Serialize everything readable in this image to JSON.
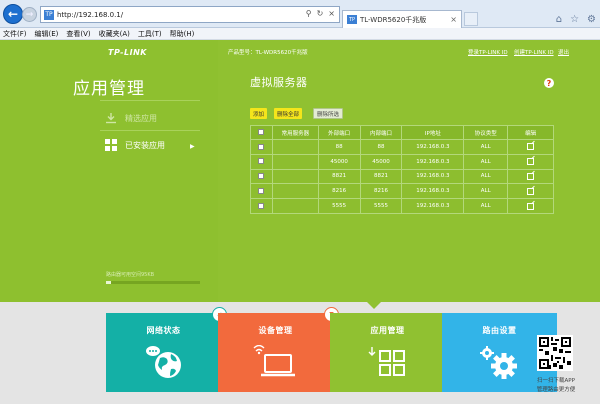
{
  "browser": {
    "url": "http://192.168.0.1/",
    "addr_favicon": "TP",
    "tab_title": "TL-WDR5620千兆版",
    "tab_favicon": "TP",
    "menu": [
      "文件(F)",
      "编辑(E)",
      "查看(V)",
      "收藏夹(A)",
      "工具(T)",
      "帮助(H)"
    ]
  },
  "header": {
    "logo": "TP-LINK",
    "model_label": "产品型号：TL-WDR5620千兆版",
    "login_id": "登录TP-LINK ID",
    "create_id": "创建TP-LINK ID",
    "exit": "退出"
  },
  "sidebar": {
    "title": "应用管理",
    "items": [
      {
        "label": "精选应用",
        "icon": "download-icon"
      },
      {
        "label": "已安装应用",
        "icon": "grid-icon",
        "arrow": "▶"
      }
    ],
    "storage_label": "路由器可用空间95KB",
    "storage_fraction": 0.05
  },
  "main": {
    "title": "虚拟服务器",
    "help": "?",
    "buttons": {
      "add": "添加",
      "delete_all": "删除全部",
      "delete_selected": "删除所选"
    },
    "columns": [
      "常用服务器",
      "外部端口",
      "内部端口",
      "IP地址",
      "协议类型",
      "编辑"
    ],
    "rows": [
      {
        "server": "",
        "external": "88",
        "internal": "88",
        "ip": "192.168.0.3",
        "protocol": "ALL"
      },
      {
        "server": "",
        "external": "45000",
        "internal": "45000",
        "ip": "192.168.0.3",
        "protocol": "ALL"
      },
      {
        "server": "",
        "external": "8821",
        "internal": "8821",
        "ip": "192.168.0.3",
        "protocol": "ALL"
      },
      {
        "server": "",
        "external": "8216",
        "internal": "8216",
        "ip": "192.168.0.3",
        "protocol": "ALL"
      },
      {
        "server": "",
        "external": "5555",
        "internal": "5555",
        "ip": "192.168.0.3",
        "protocol": "ALL"
      }
    ]
  },
  "tiles": [
    {
      "label": "网络状态",
      "color": "#14b0a6",
      "badge": "✓",
      "icon": "globe-icon"
    },
    {
      "label": "设备管理",
      "color": "#f26a3d",
      "badge": "7",
      "icon": "laptop-icon"
    },
    {
      "label": "应用管理",
      "color": "#90c131",
      "badge": "",
      "icon": "apps-icon"
    },
    {
      "label": "路由设置",
      "color": "#32b4e8",
      "badge": "",
      "icon": "gear-icon"
    }
  ],
  "qr": {
    "caption_1": "扫一扫下载APP",
    "caption_2": "管理路由更方便"
  }
}
